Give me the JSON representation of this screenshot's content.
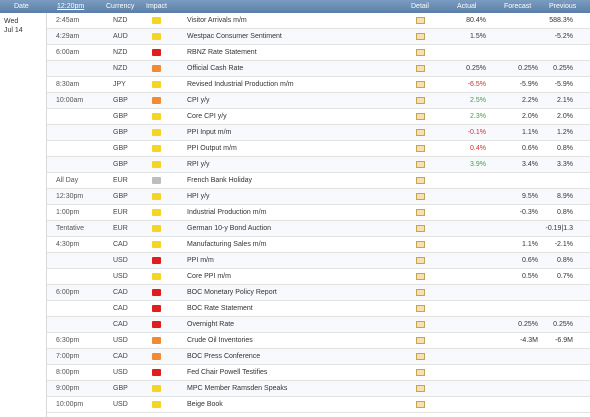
{
  "header": {
    "date": "Date",
    "time": "12:20pm",
    "currency": "Currency",
    "impact": "Impact",
    "detail": "Detail",
    "actual": "Actual",
    "forecast": "Forecast",
    "previous": "Previous"
  },
  "day": {
    "weekday": "Wed",
    "date": "Jul 14"
  },
  "colors": {
    "header_bg": "#5b7fa8",
    "high": "#e11c1c",
    "medium": "#f08a33",
    "low": "#f5d422",
    "holiday": "#bdbdbd",
    "better": "#3aa346",
    "worse": "#d62d2d"
  },
  "rows": [
    {
      "time": "2:45am",
      "currency": "NZD",
      "impact": "low",
      "event": "Visitor Arrivals m/m",
      "actual": "80.4%",
      "actual_color": "black",
      "forecast": "",
      "previous": "588.3%"
    },
    {
      "time": "4:29am",
      "currency": "AUD",
      "impact": "low",
      "event": "Westpac Consumer Sentiment",
      "actual": "1.5%",
      "actual_color": "black",
      "forecast": "",
      "previous": "-5.2%"
    },
    {
      "time": "6:00am",
      "currency": "NZD",
      "impact": "high",
      "event": "RBNZ Rate Statement",
      "actual": "",
      "actual_color": "black",
      "forecast": "",
      "previous": ""
    },
    {
      "time": "",
      "currency": "NZD",
      "impact": "medium",
      "event": "Official Cash Rate",
      "actual": "0.25%",
      "actual_color": "black",
      "forecast": "0.25%",
      "previous": "0.25%"
    },
    {
      "time": "8:30am",
      "currency": "JPY",
      "impact": "low",
      "event": "Revised Industrial Production m/m",
      "actual": "-6.5%",
      "actual_color": "red",
      "forecast": "-5.9%",
      "previous": "-5.9%"
    },
    {
      "time": "10:00am",
      "currency": "GBP",
      "impact": "medium",
      "event": "CPI y/y",
      "actual": "2.5%",
      "actual_color": "green",
      "forecast": "2.2%",
      "previous": "2.1%"
    },
    {
      "time": "",
      "currency": "GBP",
      "impact": "low",
      "event": "Core CPI y/y",
      "actual": "2.3%",
      "actual_color": "green",
      "forecast": "2.0%",
      "previous": "2.0%"
    },
    {
      "time": "",
      "currency": "GBP",
      "impact": "low",
      "event": "PPI Input m/m",
      "actual": "-0.1%",
      "actual_color": "red",
      "forecast": "1.1%",
      "previous": "1.2%"
    },
    {
      "time": "",
      "currency": "GBP",
      "impact": "low",
      "event": "PPI Output m/m",
      "actual": "0.4%",
      "actual_color": "red",
      "forecast": "0.6%",
      "previous": "0.8%"
    },
    {
      "time": "",
      "currency": "GBP",
      "impact": "low",
      "event": "RPI y/y",
      "actual": "3.9%",
      "actual_color": "green",
      "forecast": "3.4%",
      "previous": "3.3%"
    },
    {
      "time": "All Day",
      "currency": "EUR",
      "impact": "holiday",
      "event": "French Bank Holiday",
      "actual": "",
      "actual_color": "black",
      "forecast": "",
      "previous": ""
    },
    {
      "time": "12:30pm",
      "currency": "GBP",
      "impact": "low",
      "event": "HPI y/y",
      "actual": "",
      "actual_color": "black",
      "forecast": "9.5%",
      "previous": "8.9%"
    },
    {
      "time": "1:00pm",
      "currency": "EUR",
      "impact": "low",
      "event": "Industrial Production m/m",
      "actual": "",
      "actual_color": "black",
      "forecast": "-0.3%",
      "previous": "0.8%"
    },
    {
      "time": "Tentative",
      "currency": "EUR",
      "impact": "low",
      "event": "German 10-y Bond Auction",
      "actual": "",
      "actual_color": "black",
      "forecast": "",
      "previous": "-0.19|1.3"
    },
    {
      "time": "4:30pm",
      "currency": "CAD",
      "impact": "low",
      "event": "Manufacturing Sales m/m",
      "actual": "",
      "actual_color": "black",
      "forecast": "1.1%",
      "previous": "-2.1%"
    },
    {
      "time": "",
      "currency": "USD",
      "impact": "high",
      "event": "PPI m/m",
      "actual": "",
      "actual_color": "black",
      "forecast": "0.6%",
      "previous": "0.8%"
    },
    {
      "time": "",
      "currency": "USD",
      "impact": "low",
      "event": "Core PPI m/m",
      "actual": "",
      "actual_color": "black",
      "forecast": "0.5%",
      "previous": "0.7%"
    },
    {
      "time": "6:00pm",
      "currency": "CAD",
      "impact": "high",
      "event": "BOC Monetary Policy Report",
      "actual": "",
      "actual_color": "black",
      "forecast": "",
      "previous": ""
    },
    {
      "time": "",
      "currency": "CAD",
      "impact": "high",
      "event": "BOC Rate Statement",
      "actual": "",
      "actual_color": "black",
      "forecast": "",
      "previous": ""
    },
    {
      "time": "",
      "currency": "CAD",
      "impact": "high",
      "event": "Overnight Rate",
      "actual": "",
      "actual_color": "black",
      "forecast": "0.25%",
      "previous": "0.25%"
    },
    {
      "time": "6:30pm",
      "currency": "USD",
      "impact": "medium",
      "event": "Crude Oil Inventories",
      "actual": "",
      "actual_color": "black",
      "forecast": "-4.3M",
      "previous": "-6.9M"
    },
    {
      "time": "7:00pm",
      "currency": "CAD",
      "impact": "medium",
      "event": "BOC Press Conference",
      "actual": "",
      "actual_color": "black",
      "forecast": "",
      "previous": ""
    },
    {
      "time": "8:00pm",
      "currency": "USD",
      "impact": "high",
      "event": "Fed Chair Powell Testifies",
      "actual": "",
      "actual_color": "black",
      "forecast": "",
      "previous": ""
    },
    {
      "time": "9:00pm",
      "currency": "GBP",
      "impact": "low",
      "event": "MPC Member Ramsden Speaks",
      "actual": "",
      "actual_color": "black",
      "forecast": "",
      "previous": ""
    },
    {
      "time": "10:00pm",
      "currency": "USD",
      "impact": "low",
      "event": "Beige Book",
      "actual": "",
      "actual_color": "black",
      "forecast": "",
      "previous": ""
    }
  ]
}
